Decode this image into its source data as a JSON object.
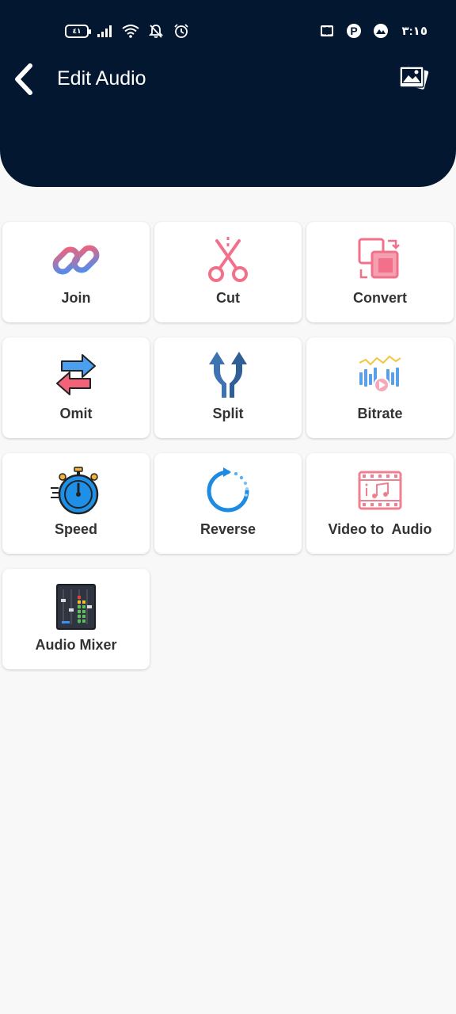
{
  "status_bar": {
    "battery_text": "٤١",
    "time": "٣:١٥",
    "left_icons": [
      "battery-icon",
      "signal-icon",
      "wifi-icon",
      "bell-off-icon",
      "alarm-icon"
    ],
    "right_icons": [
      "book-icon",
      "pinterest-icon",
      "map-icon"
    ]
  },
  "header": {
    "title": "Edit Audio",
    "background_color": "#031830",
    "back_icon": "chevron-left-icon",
    "gallery_icon": "gallery-icon"
  },
  "tools": [
    {
      "label": "Join",
      "icon": "link-icon"
    },
    {
      "label": "Cut",
      "icon": "scissors-icon"
    },
    {
      "label": "Convert",
      "icon": "convert-icon"
    },
    {
      "label": "Omit",
      "icon": "swap-arrows-icon"
    },
    {
      "label": "Split",
      "icon": "split-arrow-icon"
    },
    {
      "label": "Bitrate",
      "icon": "waveform-icon"
    },
    {
      "label": "Speed",
      "icon": "stopwatch-icon"
    },
    {
      "label": "Reverse",
      "icon": "reverse-circle-icon"
    },
    {
      "label": "Video to  Audio",
      "icon": "film-music-icon"
    },
    {
      "label": "Audio Mixer",
      "icon": "mixer-icon"
    }
  ]
}
